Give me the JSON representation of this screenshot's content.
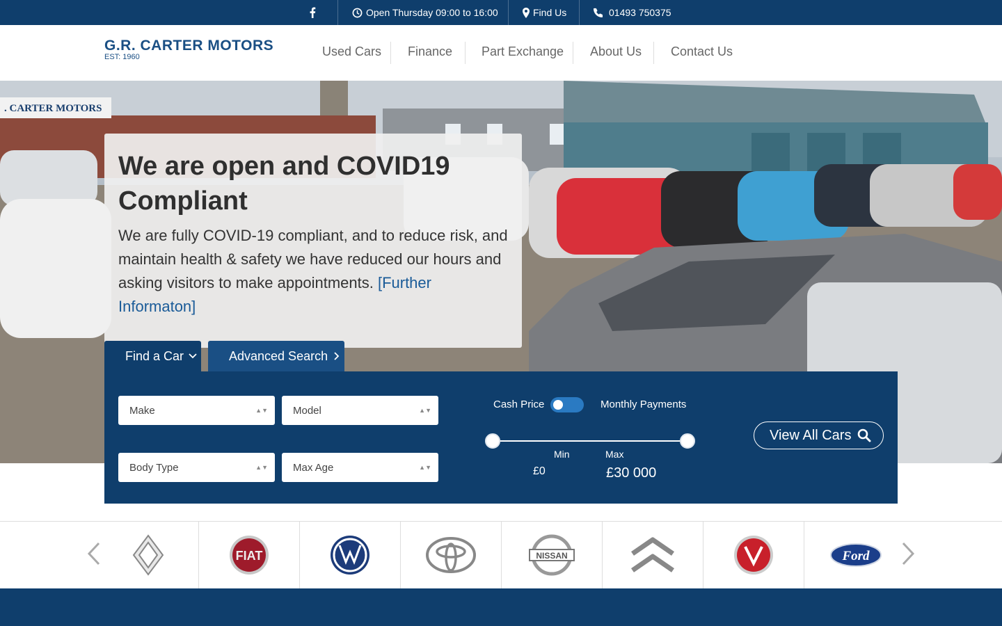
{
  "topbar": {
    "facebook_icon": "facebook-icon",
    "opening": "Open Thursday 09:00 to 16:00",
    "find_us": "Find Us",
    "phone": "01493 750375"
  },
  "header": {
    "logo_main": "G.R. CARTER MOTORS",
    "logo_sub": "EST: 1960",
    "nav": [
      "Used Cars",
      "Finance",
      "Part Exchange",
      "About Us",
      "Contact Us"
    ]
  },
  "hero": {
    "sign_text": ". CARTER MOTORS",
    "title": "We are open and COVID19 Compliant",
    "text": "We are fully COVID-19 compliant, and to reduce risk, and maintain health & safety we have reduced our hours and asking visitors to make appointments. ",
    "link_text": "[Further Informaton]"
  },
  "tabs": {
    "find": "Find a Car",
    "advanced": "Advanced Search"
  },
  "search": {
    "make": "Make",
    "model": "Model",
    "body_type": "Body Type",
    "max_age": "Max Age",
    "cash_price": "Cash Price",
    "monthly": "Monthly Payments",
    "min_label": "Min",
    "max_label": "Max",
    "min_value": "£0",
    "max_value": "£30 000",
    "view_all": "View All Cars"
  },
  "brands": [
    "Renault",
    "Fiat",
    "Volkswagen",
    "Toyota",
    "Nissan",
    "Citroen",
    "Vauxhall",
    "Ford"
  ],
  "colors": {
    "navy": "#0f3e6c",
    "accent_blue": "#1a5b98",
    "toggle_blue": "#2a7ac2"
  }
}
